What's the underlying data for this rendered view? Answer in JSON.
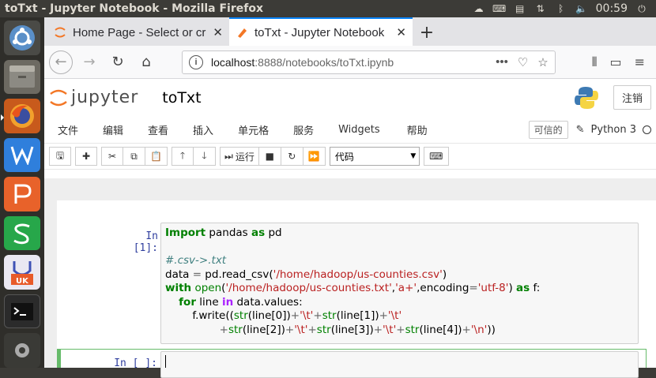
{
  "os": {
    "window_title": "toTxt - Jupyter Notebook - Mozilla Firefox",
    "clock": "00:59"
  },
  "browser": {
    "tabs": [
      {
        "label": "Home Page - Select or cre",
        "active": false
      },
      {
        "label": "toTxt - Jupyter Notebook",
        "active": true
      }
    ],
    "url_host": "localhost",
    "url_path": ":8888/notebooks/toTxt.ipynb",
    "url_more": "•••"
  },
  "jupyter": {
    "logo_text": "jupyter",
    "notebook_name": "toTxt",
    "logout_label": "注销",
    "menu": [
      "文件",
      "编辑",
      "查看",
      "插入",
      "单元格",
      "服务",
      "Widgets",
      "帮助"
    ],
    "trusted_label": "可信的",
    "kernel_name": "Python 3",
    "run_label": "运行",
    "cell_type": "代码"
  },
  "cells": [
    {
      "prompt": "In [1]:"
    },
    {
      "prompt": "In [ ]:"
    }
  ],
  "colors": {
    "accent": "#0a84ff",
    "prompt": "#303f9f",
    "edit_mode": "#66bb6a"
  }
}
